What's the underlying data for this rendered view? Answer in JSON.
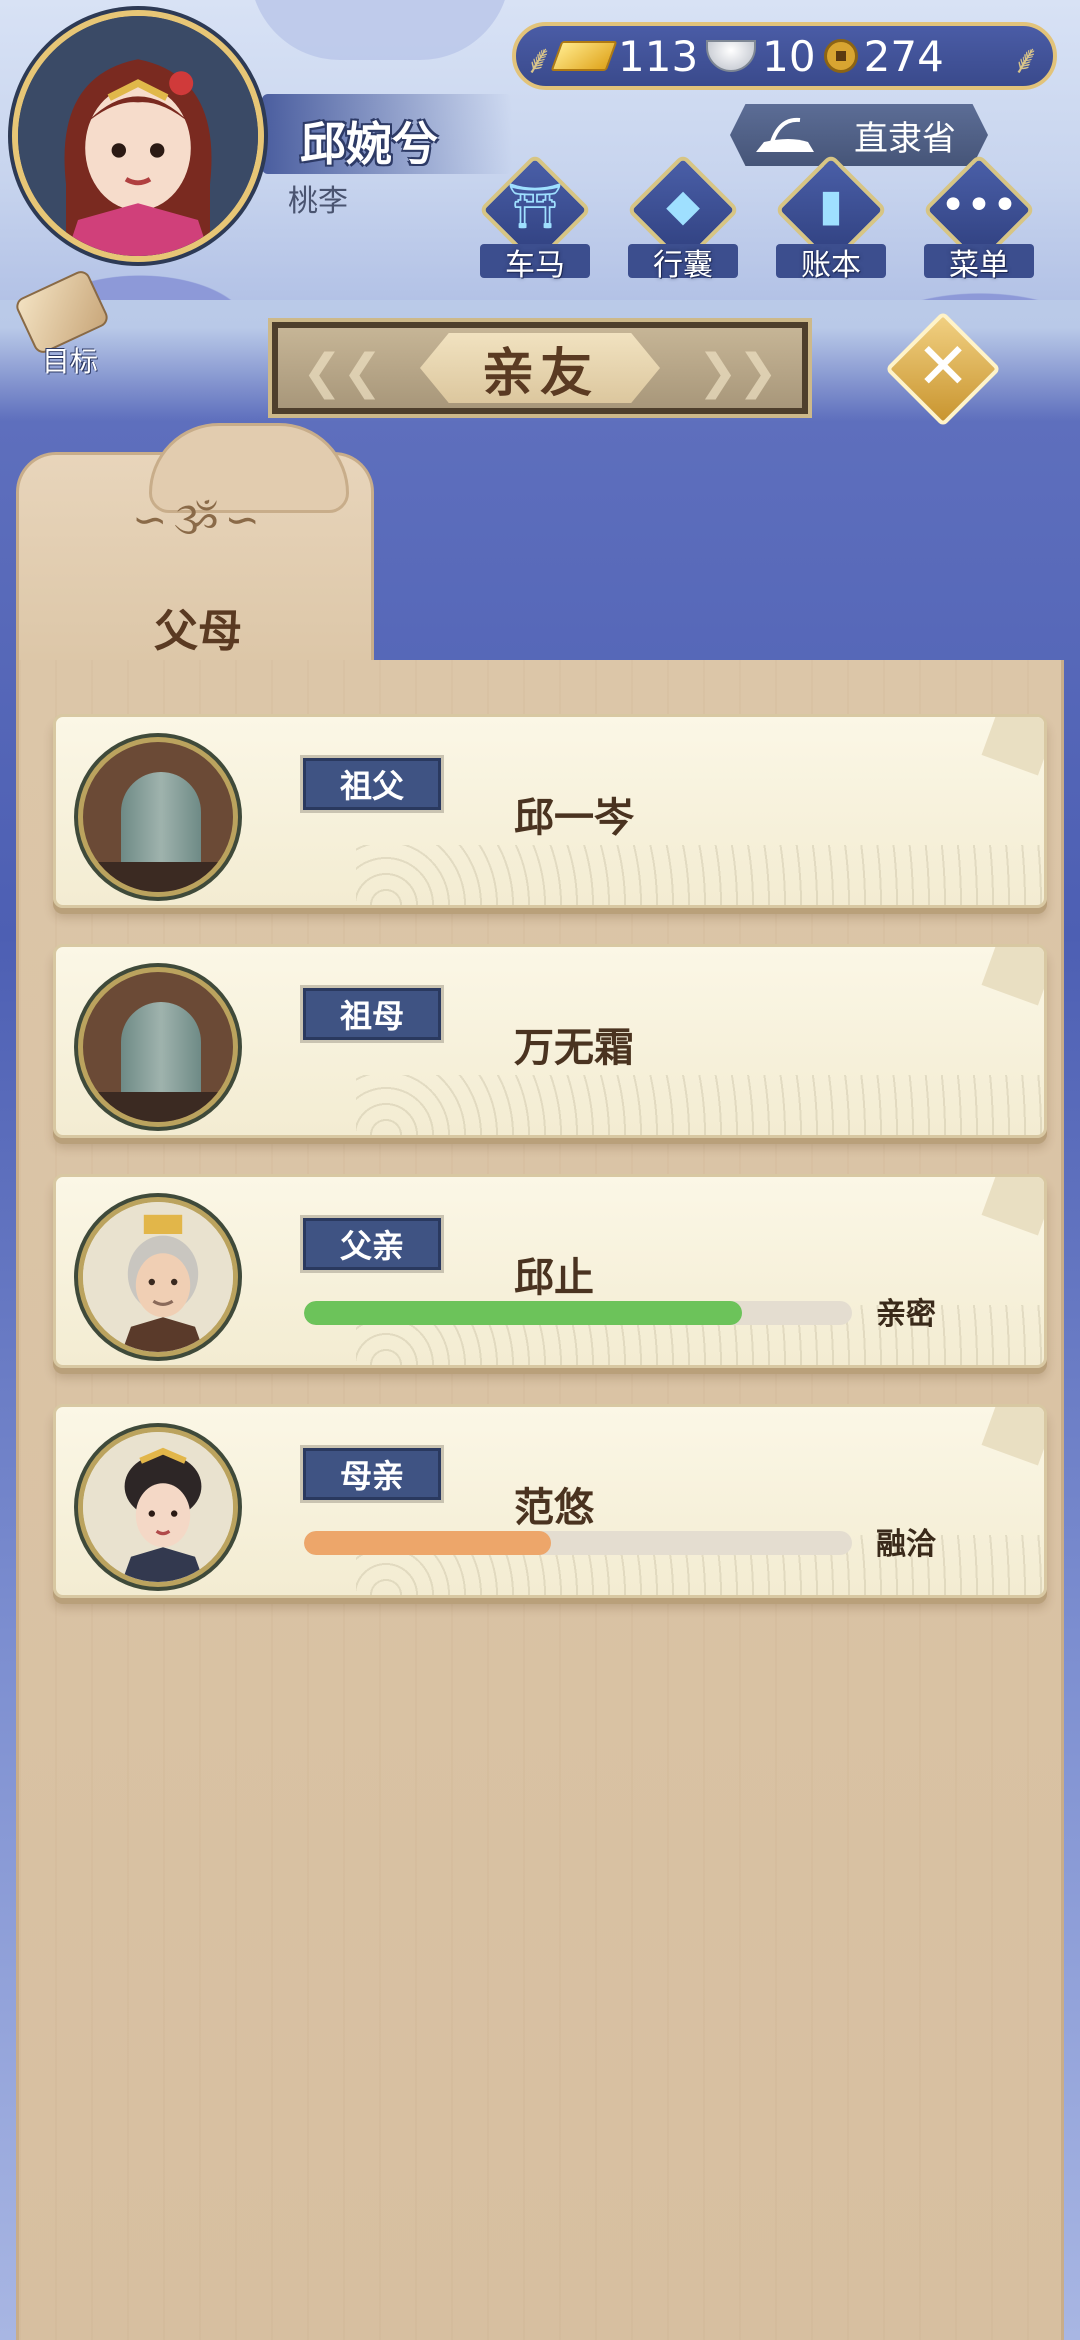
{
  "header": {
    "player_name": "邱婉兮",
    "player_title": "桃李",
    "currencies": [
      {
        "icon": "gold-bar-icon",
        "value": "113"
      },
      {
        "icon": "silver-ingot-icon",
        "value": "10"
      },
      {
        "icon": "copper-coin-icon",
        "value": "274"
      }
    ],
    "location": "直隶省",
    "menu": [
      {
        "label": "车马",
        "icon": "carriage-icon"
      },
      {
        "label": "行囊",
        "icon": "bag-icon"
      },
      {
        "label": "账本",
        "icon": "ledger-icon"
      },
      {
        "label": "菜单",
        "icon": "more-icon"
      }
    ],
    "goal_label": "目标"
  },
  "panel": {
    "title": "亲友",
    "tab_label": "父母"
  },
  "members": [
    {
      "role": "祖父",
      "name": "邱一岑",
      "deceased": true,
      "relation": null
    },
    {
      "role": "祖母",
      "name": "万无霜",
      "deceased": true,
      "relation": null
    },
    {
      "role": "父亲",
      "name": "邱止",
      "deceased": false,
      "relation": {
        "label": "亲密",
        "fill_fraction": 0.8,
        "color": "#6cc35a"
      }
    },
    {
      "role": "母亲",
      "name": "范悠",
      "deceased": false,
      "relation": {
        "label": "融洽",
        "fill_fraction": 0.45,
        "color": "#eda66a"
      }
    }
  ],
  "colors": {
    "badge": "#3f5383",
    "accent_gold": "#e2c37a",
    "panel_bg": "#dcc6a8"
  }
}
